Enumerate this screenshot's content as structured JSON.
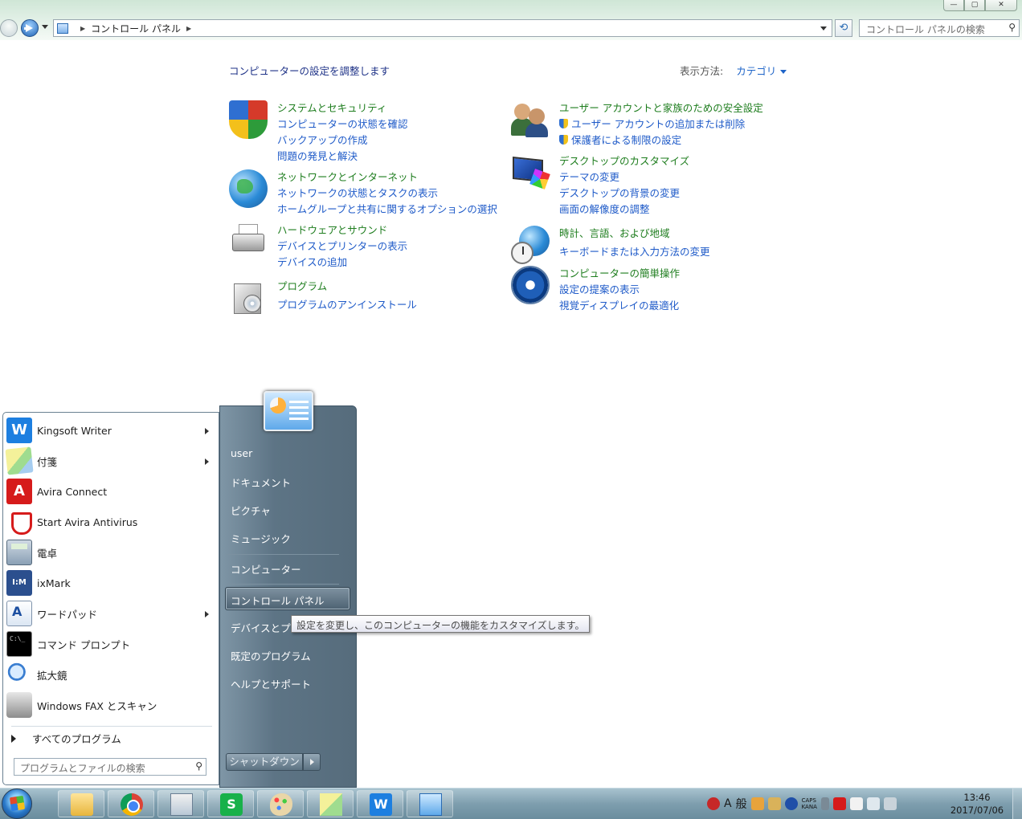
{
  "window": {
    "address": "コントロール パネル",
    "search_placeholder": "コントロール パネルの検索",
    "buttons": {
      "minimize": "—",
      "maximize": "▢",
      "close": "✕"
    }
  },
  "control_panel": {
    "header": "コンピューターの設定を調整します",
    "view_by_label": "表示方法:",
    "view_by_value": "カテゴリ",
    "left_categories": [
      {
        "title": "システムとセキュリティ",
        "icon": "security-shield-icon",
        "links": [
          "コンピューターの状態を確認",
          "バックアップの作成",
          "問題の発見と解決"
        ]
      },
      {
        "title": "ネットワークとインターネット",
        "icon": "network-globe-icon",
        "links": [
          "ネットワークの状態とタスクの表示",
          "ホームグループと共有に関するオプションの選択"
        ]
      },
      {
        "title": "ハードウェアとサウンド",
        "icon": "printer-icon",
        "links": [
          "デバイスとプリンターの表示",
          "デバイスの追加"
        ]
      },
      {
        "title": "プログラム",
        "icon": "programs-box-icon",
        "links": [
          "プログラムのアンインストール"
        ]
      }
    ],
    "right_categories": [
      {
        "title": "ユーザー アカウントと家族のための安全設定",
        "icon": "users-icon",
        "links": [
          "ユーザー アカウントの追加または削除",
          "保護者による制限の設定"
        ]
      },
      {
        "title": "デスクトップのカスタマイズ",
        "icon": "desktop-monitor-icon",
        "links": [
          "テーマの変更",
          "デスクトップの背景の変更",
          "画面の解像度の調整"
        ]
      },
      {
        "title": "時計、言語、および地域",
        "icon": "clock-globe-icon",
        "links": [
          "キーボードまたは入力方法の変更"
        ]
      },
      {
        "title": "コンピューターの簡単操作",
        "icon": "ease-of-access-icon",
        "links": [
          "設定の提案の表示",
          "視覚ディスプレイの最適化"
        ]
      }
    ]
  },
  "start_menu": {
    "programs": [
      {
        "label": "Kingsoft Writer",
        "icon": "kingsoft-writer-icon",
        "submenu": true
      },
      {
        "label": "付箋",
        "icon": "sticky-notes-icon",
        "submenu": true
      },
      {
        "label": "Avira Connect",
        "icon": "avira-connect-icon",
        "submenu": false
      },
      {
        "label": "Start Avira Antivirus",
        "icon": "avira-antivirus-icon",
        "submenu": false
      },
      {
        "label": "電卓",
        "icon": "calculator-icon",
        "submenu": false
      },
      {
        "label": "ixMark",
        "icon": "ixmark-icon",
        "submenu": false
      },
      {
        "label": "ワードパッド",
        "icon": "wordpad-icon",
        "submenu": true
      },
      {
        "label": "コマンド プロンプト",
        "icon": "command-prompt-icon",
        "submenu": false
      },
      {
        "label": "拡大鏡",
        "icon": "magnifier-icon",
        "submenu": false
      },
      {
        "label": "Windows FAX とスキャン",
        "icon": "fax-scan-icon",
        "submenu": false
      }
    ],
    "all_programs": "すべてのプログラム",
    "search_placeholder": "プログラムとファイルの検索",
    "right_items": {
      "user": "user",
      "documents": "ドキュメント",
      "pictures": "ピクチャ",
      "music": "ミュージック",
      "computer": "コンピューター",
      "control_panel": "コントロール パネル",
      "devices": "デバイスとプ",
      "default_programs": "既定のプログラム",
      "help": "ヘルプとサポート"
    },
    "shutdown": "シャットダウン",
    "tooltip": "設定を変更し、このコンピューターの機能をカスタマイズします。"
  },
  "taskbar": {
    "apps": [
      "explorer-folder-icon",
      "chrome-icon",
      "messenger-icon",
      "wps-spreadsheets-icon",
      "paint-icon",
      "sticky-notes-icon",
      "kingsoft-writer-icon",
      "control-panel-icon"
    ],
    "ime_mode": "A",
    "ime_kanji": "般",
    "caps": "CAPS",
    "kana": "KANA",
    "time": "13:46",
    "date": "2017/07/06"
  }
}
